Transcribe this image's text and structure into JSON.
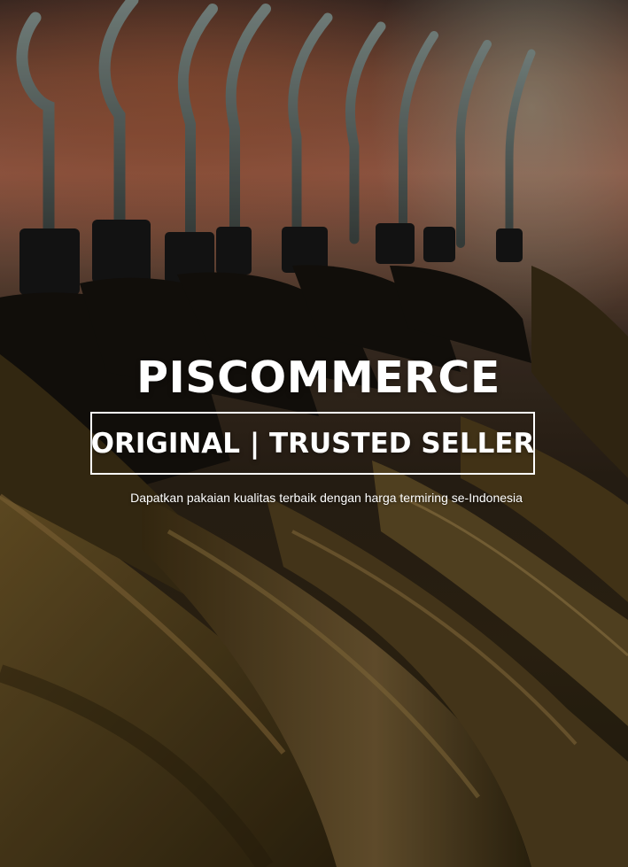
{
  "hero": {
    "brand": "PISCOMMERCE",
    "tagline": "ORIGINAL | TRUSTED SELLER",
    "subtitle": "Dapatkan pakaian kualitas terbaik dengan harga termiring se-Indonesia",
    "background": "clothes-on-hangers-photo"
  },
  "colors": {
    "text": "#ffffff",
    "garment": "#4a3a1c",
    "hanger": "#1b1b1b",
    "backdrop_warm": "#a0604a"
  }
}
